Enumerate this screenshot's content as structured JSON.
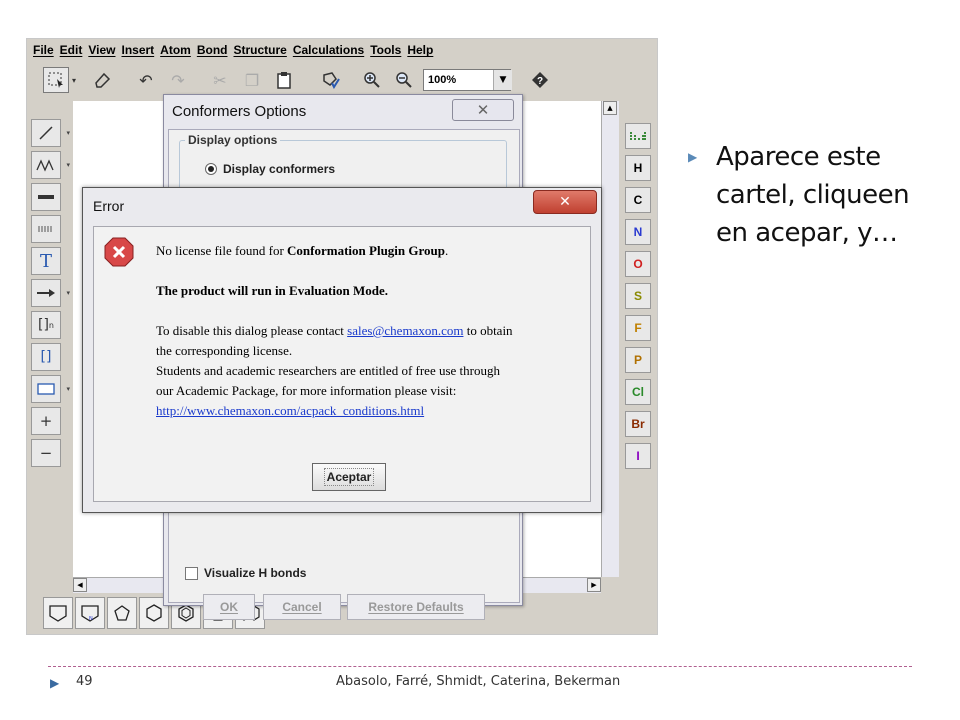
{
  "app": {
    "menu": [
      "File",
      "Edit",
      "View",
      "Insert",
      "Atom",
      "Bond",
      "Structure",
      "Calculations",
      "Tools",
      "Help"
    ],
    "zoom_value": "100%",
    "right_elements": [
      "H",
      "C",
      "N",
      "O",
      "S",
      "F",
      "P",
      "Cl",
      "Br",
      "I"
    ],
    "element_colors": [
      "#333333",
      "#333333",
      "#2a3ad0",
      "#d02020",
      "#8a8a00",
      "#c08000",
      "#b07000",
      "#2a8a2a",
      "#8a2a00",
      "#8a00c0"
    ],
    "left_tools": {
      "text_tool": "T",
      "bracket_tool": "[]",
      "plus": "+",
      "minus": "−"
    }
  },
  "conformers_dialog": {
    "title": "Conformers Options",
    "group_label": "Display options",
    "option_display": "Display conformers",
    "option_visualize_h": "Visualize H bonds",
    "ok": "OK",
    "cancel": "Cancel",
    "restore": "Restore Defaults"
  },
  "error_dialog": {
    "title": "Error",
    "line1_a": "No license file found for ",
    "line1_b": "Conformation Plugin Group",
    "line1_c": ".",
    "line2": "The product will run in Evaluation Mode.",
    "line3_a": "To disable this dialog please contact ",
    "line3_link": "sales@chemaxon.com",
    "line3_b": " to obtain",
    "line4": "the corresponding license.",
    "line5": "Students and academic researchers are entitled of free use through",
    "line6": "our Academic Package, for more information please visit:",
    "line7_link": "http://www.chemaxon.com/acpack_conditions.html",
    "accept": "Aceptar"
  },
  "slide": {
    "note": "Aparece este cartel, cliqueen en acepar, y…",
    "page_number": "49",
    "authors": "Abasolo, Farré, Shmidt, Caterina, Bekerman"
  }
}
